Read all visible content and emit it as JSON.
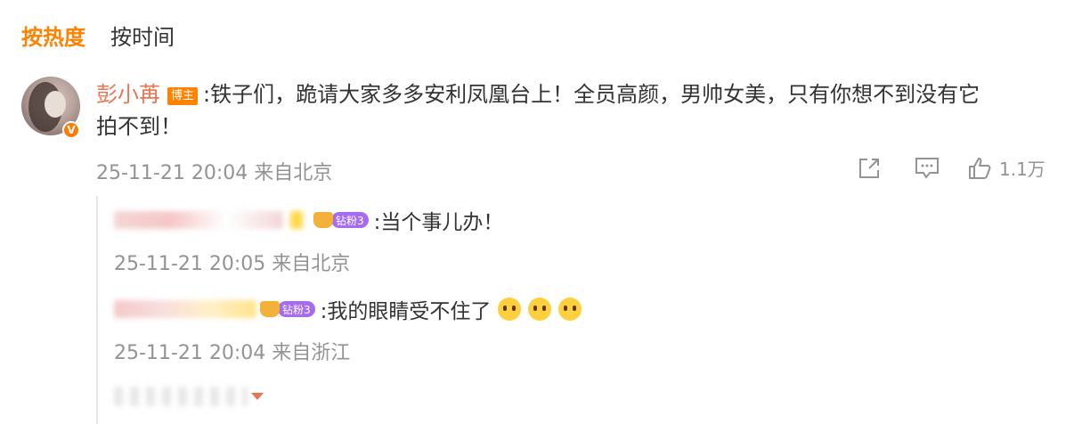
{
  "tabs": {
    "hot": "按热度",
    "time": "按时间"
  },
  "comment": {
    "author": "彭小苒",
    "role_tag": "博主",
    "text_line1": ":铁子们，跪请大家多多安利凤凰台上！全员高颜，男帅女美，只有你想不到没有它",
    "text_line2": "拍不到！",
    "time": "25-11-21 20:04 来自北京",
    "like_count": "1.1万",
    "verified_badge": "V"
  },
  "replies": [
    {
      "fan_badge": "钻粉3",
      "text": ":当个事儿办！",
      "time": "25-11-21 20:05 来自北京"
    },
    {
      "fan_badge": "钻粉3",
      "text": ":我的眼睛受不住了",
      "time": "25-11-21 20:04 来自浙江"
    }
  ],
  "colors": {
    "accent": "#ff8200",
    "author": "#eb7350",
    "meta": "#939393",
    "fan_badge": "#a66cf0"
  },
  "icons": [
    "share-icon",
    "comment-icon",
    "like-icon",
    "crying-emoji-icon",
    "crown-icon",
    "expand-arrow-icon"
  ]
}
